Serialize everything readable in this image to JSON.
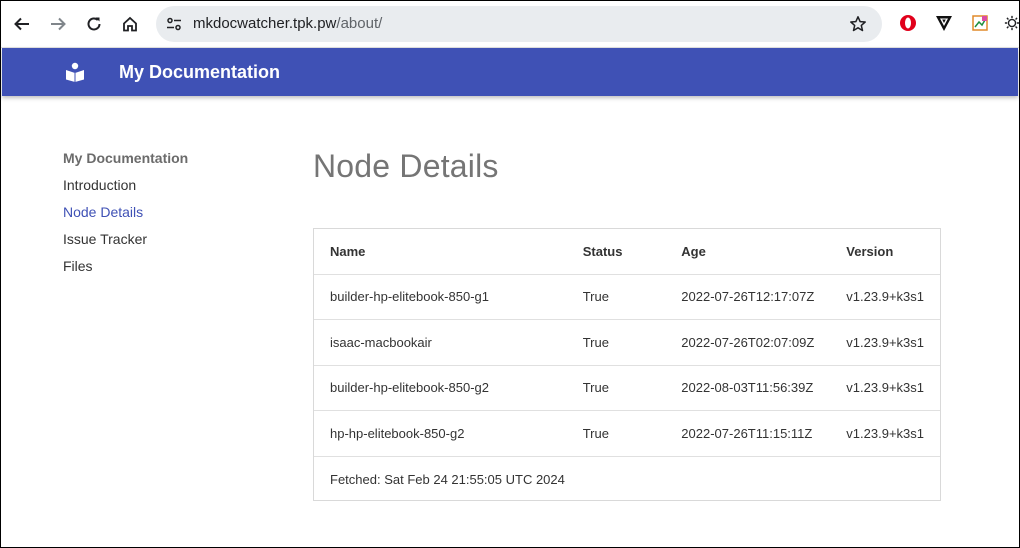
{
  "browser": {
    "url_host": "mkdocwatcher.tpk.pw",
    "url_path": "/about/"
  },
  "header": {
    "site_title": "My Documentation"
  },
  "nav": {
    "heading": "My Documentation",
    "items": [
      {
        "label": "Introduction",
        "active": false
      },
      {
        "label": "Node Details",
        "active": true
      },
      {
        "label": "Issue Tracker",
        "active": false
      },
      {
        "label": "Files",
        "active": false
      }
    ]
  },
  "main": {
    "title": "Node Details",
    "table": {
      "headers": [
        "Name",
        "Status",
        "Age",
        "Version"
      ],
      "rows": [
        [
          "builder-hp-elitebook-850-g1",
          "True",
          "2022-07-26T12:17:07Z",
          "v1.23.9+k3s1"
        ],
        [
          "isaac-macbookair",
          "True",
          "2022-07-26T02:07:09Z",
          "v1.23.9+k3s1"
        ],
        [
          "builder-hp-elitebook-850-g2",
          "True",
          "2022-08-03T11:56:39Z",
          "v1.23.9+k3s1"
        ],
        [
          "hp-hp-elitebook-850-g2",
          "True",
          "2022-07-26T11:15:11Z",
          "v1.23.9+k3s1"
        ]
      ],
      "footer": "Fetched: Sat Feb 24 21:55:05 UTC 2024"
    }
  },
  "colors": {
    "primary": "#3f51b5",
    "title_gray": "#757575"
  },
  "icons": [
    "back-icon",
    "forward-icon",
    "reload-icon",
    "home-icon",
    "site-settings-icon",
    "bookmark-star-icon",
    "opera-extension-icon",
    "vivaldi-extension-icon",
    "image-extension-icon",
    "sun-extension-icon",
    "book-reader-logo-icon"
  ]
}
